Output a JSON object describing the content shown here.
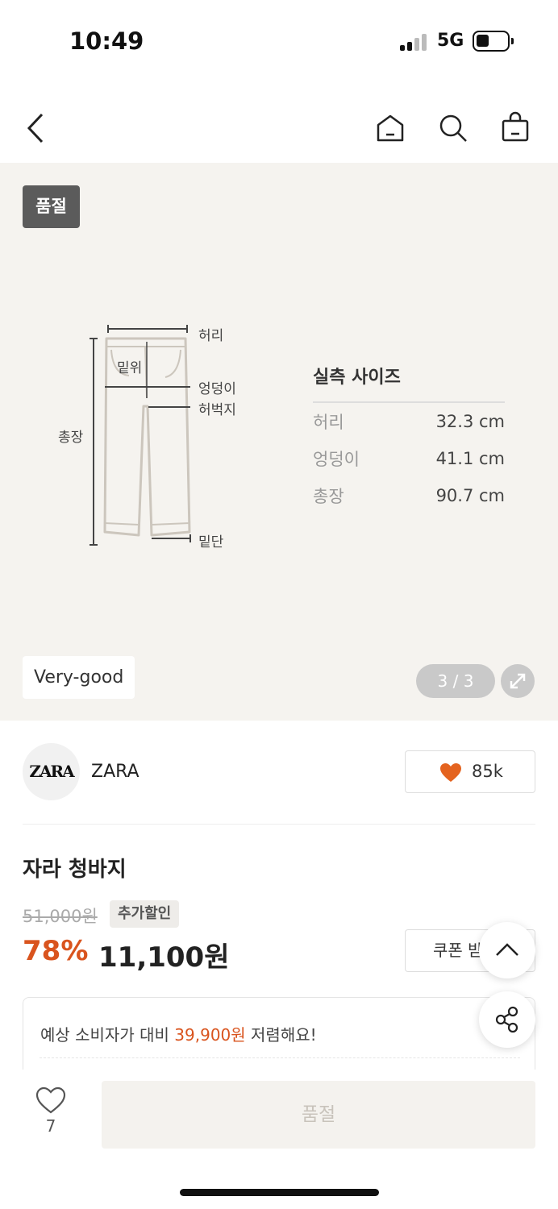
{
  "status_bar": {
    "time": "10:49",
    "network": "5G"
  },
  "nav": {
    "back_icon": "chevron-left-icon",
    "home_icon": "home-icon",
    "search_icon": "search-icon",
    "bag_icon": "shopping-bag-icon"
  },
  "product_image": {
    "soldout_badge": "품절",
    "diagram_labels": {
      "waist": "허리",
      "rise": "밑위",
      "hip": "엉덩이",
      "thigh": "허벅지",
      "length": "총장",
      "hem": "밑단"
    },
    "size_title": "실측 사이즈",
    "sizes": [
      {
        "label": "허리",
        "value": "32.3 cm"
      },
      {
        "label": "엉덩이",
        "value": "41.1 cm"
      },
      {
        "label": "총장",
        "value": "90.7 cm"
      }
    ],
    "grade": "Very-good",
    "page_counter": "3 / 3"
  },
  "brand": {
    "logo_text": "ZARA",
    "name": "ZARA",
    "likes": "85k"
  },
  "product": {
    "title": "자라 청바지",
    "original_price": "51,000원",
    "extra_discount_badge": "추가할인",
    "discount_rate": "78%",
    "sale_price": "11,100원",
    "coupon_label": "쿠폰 받"
  },
  "savings": {
    "prefix": "예상 소비자가 대비",
    "amount": "39,900원",
    "suffix": "저렴해요!"
  },
  "bottom_bar": {
    "wish_count": "7",
    "action_label": "품절"
  },
  "colors": {
    "accent": "#d9541e",
    "image_bg": "#f5f3ef",
    "badge_bg": "#5b5b5b"
  }
}
